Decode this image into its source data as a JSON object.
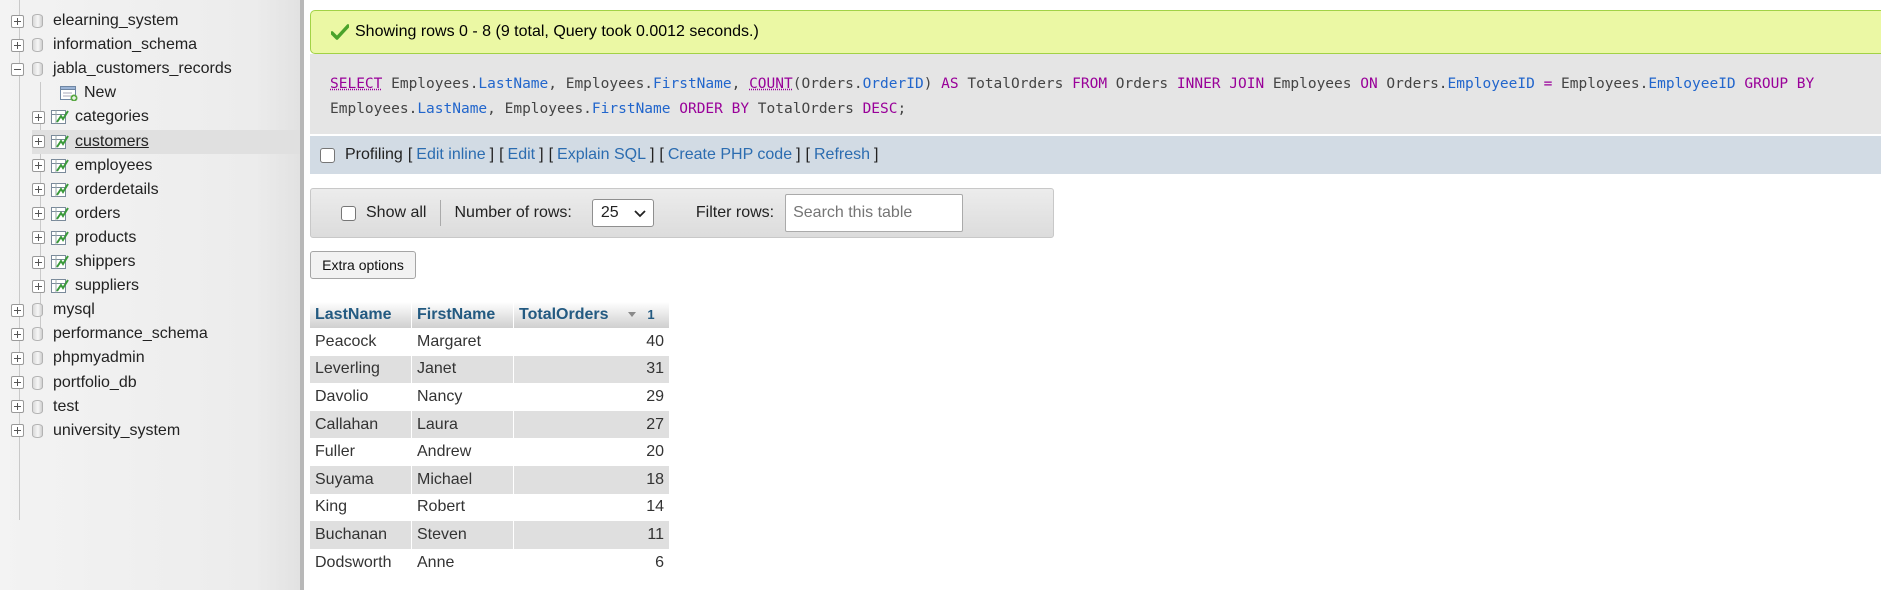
{
  "sidebar": {
    "databases_before": [
      {
        "label": "elearning_system"
      },
      {
        "label": "information_schema"
      }
    ],
    "expanded_db": {
      "label": "jabla_customers_records",
      "new_label": "New",
      "tables": [
        {
          "label": "categories"
        },
        {
          "label": "customers"
        },
        {
          "label": "employees"
        },
        {
          "label": "orderdetails"
        },
        {
          "label": "orders"
        },
        {
          "label": "products"
        },
        {
          "label": "shippers"
        },
        {
          "label": "suppliers"
        }
      ]
    },
    "databases_after": [
      {
        "label": "mysql"
      },
      {
        "label": "performance_schema"
      },
      {
        "label": "phpmyadmin"
      },
      {
        "label": "portfolio_db"
      },
      {
        "label": "test"
      },
      {
        "label": "university_system"
      }
    ]
  },
  "message": {
    "text": "Showing rows 0 - 8 (9 total, Query took 0.0012 seconds.)",
    "color": "#ebf8a4"
  },
  "query": {
    "tokens": [
      {
        "t": "SELECT",
        "c": "fn"
      },
      {
        "t": " Employees.",
        "c": ""
      },
      {
        "t": "LastName",
        "c": "col"
      },
      {
        "t": ", Employees.",
        "c": ""
      },
      {
        "t": "FirstName",
        "c": "col"
      },
      {
        "t": ", ",
        "c": ""
      },
      {
        "t": "COUNT",
        "c": "fn"
      },
      {
        "t": "(Orders.",
        "c": ""
      },
      {
        "t": "OrderID",
        "c": "col"
      },
      {
        "t": ") ",
        "c": ""
      },
      {
        "t": "AS",
        "c": "kw"
      },
      {
        "t": " TotalOrders ",
        "c": ""
      },
      {
        "t": "FROM",
        "c": "kw"
      },
      {
        "t": " Orders ",
        "c": ""
      },
      {
        "t": "INNER JOIN",
        "c": "kw"
      },
      {
        "t": " Employees ",
        "c": ""
      },
      {
        "t": "ON",
        "c": "kw"
      },
      {
        "t": " Orders.",
        "c": ""
      },
      {
        "t": "EmployeeID",
        "c": "col"
      },
      {
        "t": " ",
        "c": ""
      },
      {
        "t": "=",
        "c": "op"
      },
      {
        "t": " Employees.",
        "c": ""
      },
      {
        "t": "EmployeeID",
        "c": "col"
      },
      {
        "t": " ",
        "c": ""
      },
      {
        "t": "GROUP BY",
        "c": "kw"
      },
      {
        "t": " Employees.",
        "c": ""
      },
      {
        "t": "LastName",
        "c": "col"
      },
      {
        "t": ", Employees.",
        "c": ""
      },
      {
        "t": "FirstName",
        "c": "col"
      },
      {
        "t": " ",
        "c": ""
      },
      {
        "t": "ORDER BY",
        "c": "kw"
      },
      {
        "t": " TotalOrders ",
        "c": ""
      },
      {
        "t": "DESC",
        "c": "kw"
      },
      {
        "t": ";",
        "c": ""
      }
    ]
  },
  "toolbar": {
    "profiling_label": "Profiling",
    "open_bracket": "[",
    "close_bracket": "]",
    "links": [
      "Edit inline",
      "Edit",
      "Explain SQL",
      "Create PHP code",
      "Refresh"
    ]
  },
  "nav": {
    "show_all_label": "Show all",
    "rows_label": "Number of rows:",
    "rows_value": "25",
    "filter_label": "Filter rows:",
    "filter_placeholder": "Search this table"
  },
  "extra_options_label": "Extra options",
  "table": {
    "headers": [
      "LastName",
      "FirstName",
      "TotalOrders"
    ],
    "sort_index": "1",
    "rows": [
      [
        "Peacock",
        "Margaret",
        "40"
      ],
      [
        "Leverling",
        "Janet",
        "31"
      ],
      [
        "Davolio",
        "Nancy",
        "29"
      ],
      [
        "Callahan",
        "Laura",
        "27"
      ],
      [
        "Fuller",
        "Andrew",
        "20"
      ],
      [
        "Suyama",
        "Michael",
        "18"
      ],
      [
        "King",
        "Robert",
        "14"
      ],
      [
        "Buchanan",
        "Steven",
        "11"
      ],
      [
        "Dodsworth",
        "Anne",
        "6"
      ]
    ]
  }
}
